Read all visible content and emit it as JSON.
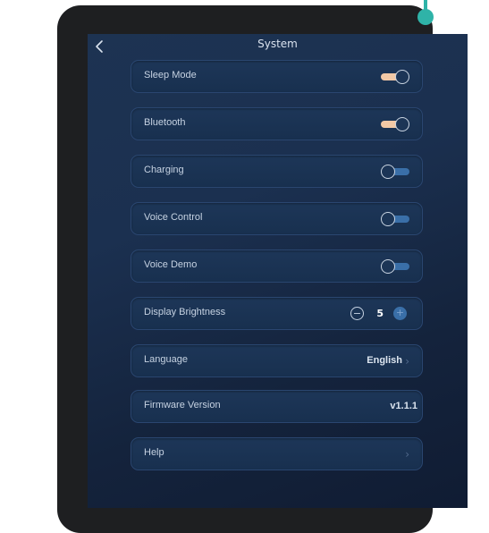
{
  "header": {
    "title": "System",
    "back_icon": "chevron-left-icon"
  },
  "settings": [
    {
      "label": "Sleep Mode",
      "type": "toggle",
      "state": "on"
    },
    {
      "label": "Bluetooth",
      "type": "toggle",
      "state": "on"
    },
    {
      "label": "Charging",
      "type": "toggle",
      "state": "off"
    },
    {
      "label": "Voice Control",
      "type": "toggle",
      "state": "off"
    },
    {
      "label": "Voice Demo",
      "type": "toggle",
      "state": "off"
    },
    {
      "label": "Display Brightness",
      "type": "stepper",
      "value": "5",
      "minus": "−",
      "plus": "+"
    },
    {
      "label": "Language",
      "type": "select",
      "value": "English",
      "chevron": "›"
    },
    {
      "label": "Firmware Version",
      "type": "info",
      "value": "v1.1.1"
    },
    {
      "label": "Help",
      "type": "link",
      "chevron": "›"
    }
  ],
  "colors": {
    "toggle_on": "#f2c9a6",
    "toggle_off": "#3a6fa8",
    "accent_dot": "#2fb3a8"
  }
}
